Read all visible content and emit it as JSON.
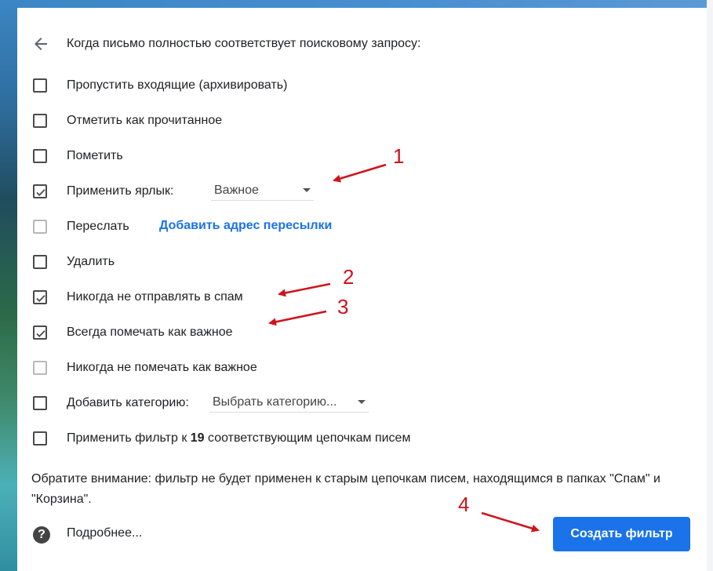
{
  "header": {
    "back_icon": "arrow-left-icon",
    "title": "Когда письмо полностью соответствует поисковому запросу:"
  },
  "options": [
    {
      "label": "Пропустить входящие (архивировать)",
      "checked": false,
      "enabled": true
    },
    {
      "label": "Отметить как прочитанное",
      "checked": false,
      "enabled": true
    },
    {
      "label": "Пометить",
      "checked": false,
      "enabled": true
    },
    {
      "label": "Применить ярлык:",
      "checked": true,
      "enabled": true
    },
    {
      "label": "Переслать",
      "checked": false,
      "enabled": false
    },
    {
      "label": "Удалить",
      "checked": false,
      "enabled": true
    },
    {
      "label": "Никогда не отправлять в спам",
      "checked": true,
      "enabled": true
    },
    {
      "label": "Всегда помечать как важное",
      "checked": true,
      "enabled": true
    },
    {
      "label": "Никогда не помечать как важное",
      "checked": false,
      "enabled": false
    },
    {
      "label": "Добавить категорию:",
      "checked": false,
      "enabled": true
    },
    {
      "label_before": "Применить фильтр к ",
      "count": "19",
      "label_after": " соответствующим цепочкам писем",
      "checked": false,
      "enabled": true
    }
  ],
  "label_select": {
    "value": "Важное"
  },
  "forward_link": "Добавить адрес пересылки",
  "category_select": {
    "value": "Выбрать категорию..."
  },
  "note": "Обратите внимание: фильтр не будет применен к старым цепочкам писем, находящимся в папках \"Спам\" и \"Корзина\".",
  "help": {
    "icon": "help-circle-icon",
    "label": "Подробнее..."
  },
  "create_button": "Создать фильтр",
  "annotations": [
    "1",
    "2",
    "3",
    "4"
  ],
  "colors": {
    "accent": "#1a73e8",
    "annotation": "#d0121b"
  }
}
